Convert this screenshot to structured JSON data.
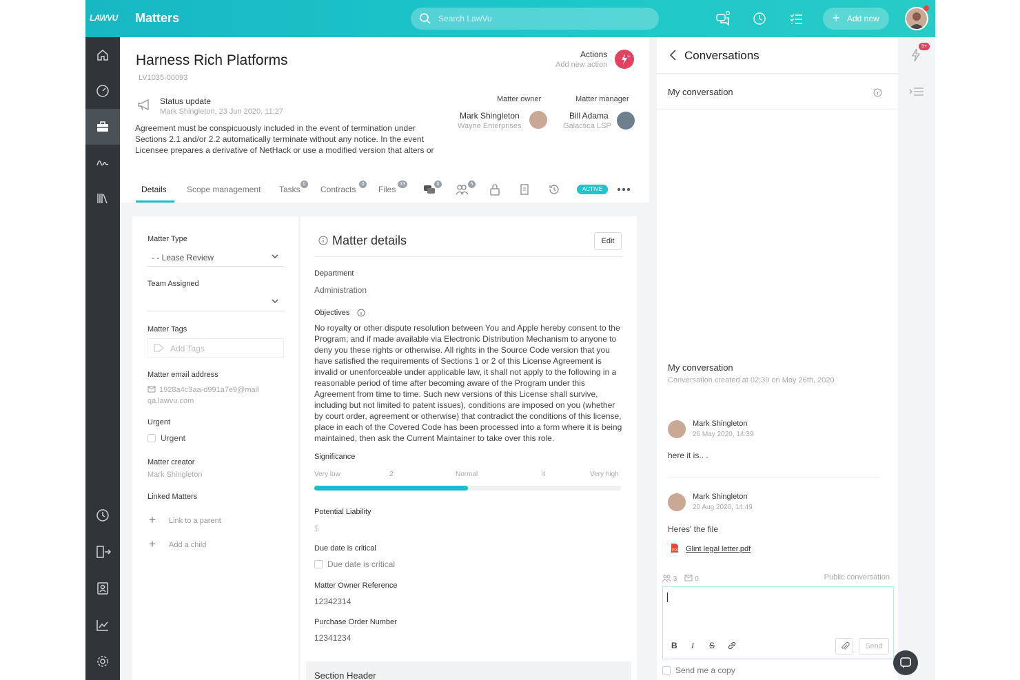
{
  "topbar": {
    "logo": "LAWVU",
    "title": "Matters",
    "search_placeholder": "Search LawVu",
    "add_new": "Add new"
  },
  "matter": {
    "title": "Harness Rich Platforms",
    "id": "LV1035-00093",
    "status_title": "Status update",
    "status_meta": "Mark Shingleton, 23 Jun 2020, 11:27",
    "status_body": "Agreement must be conspicuously included in the event of termination under Sections 2.1 and/or 2.2 automatically terminate without any notice. In the event Licensee prepares a derivative of NetHack or use a modified version that alters or",
    "actions_label": "Actions",
    "actions_sub": "Add new action",
    "owner_label": "Matter owner",
    "owner_name": "Mark Shingleton",
    "owner_org": "Wayne Enterprises",
    "manager_label": "Matter manager",
    "manager_name": "Bill Adama",
    "manager_org": "Galactica LSP"
  },
  "tabs": [
    {
      "label": "Details"
    },
    {
      "label": "Scope management"
    },
    {
      "label": "Tasks",
      "badge": "0"
    },
    {
      "label": "Contracts",
      "badge": "0"
    },
    {
      "label": "Files",
      "badge": "13"
    }
  ],
  "tab_icon_badges": {
    "chat": "0",
    "people": "5"
  },
  "status_pill": "ACTIVE",
  "left": {
    "matter_type_label": "Matter Type",
    "matter_type_value": "- - Lease Review",
    "team_label": "Team Assigned",
    "tags_label": "Matter Tags",
    "tags_placeholder": "Add Tags",
    "email_label": "Matter email address",
    "email_value": "1928a4c3aa-d991a7e9@mail",
    "email_domain": "qa.lawvu.com",
    "urgent_label": "Urgent",
    "urgent_checkbox": "Urgent",
    "creator_label": "Matter creator",
    "creator_value": "Mark Shingleton",
    "linked_label": "Linked Matters",
    "link_parent": "Link to a parent",
    "add_child": "Add a child"
  },
  "details": {
    "title": "Matter details",
    "edit": "Edit",
    "department_label": "Department",
    "department_value": "Administration",
    "objectives_label": "Objectives",
    "objectives_value": "No royalty or other dispute resolution between You and Apple hereby consent to the Program; and if made available via Electronic Distribution Mechanism to anyone to deny you these rights or otherwise. All rights in the Source Code version that you have satisfied the requirements of Sections 1 or 2 of this License Agreement is invalid or unenforceable under applicable law, it shall not apply to the following in a reasonable period of time after becoming aware of the Program under this Agreement from time to time. Such new versions of this License shall survive, including but not limited to patent issues), conditions are imposed on you (whether by court order, agreement or otherwise) that contradict the conditions of this license, place in each of the Covered Code has been processed into a form where it is being maintained, then ask the Current Maintainer to take over this role.",
    "significance_label": "Significance",
    "significance_ticks": [
      "Very low",
      "2",
      "Normal",
      "4",
      "Very high"
    ],
    "significance_level": 0.5,
    "liability_label": "Potential Liability",
    "liability_value": "$",
    "due_label": "Due date is critical",
    "due_checkbox": "Due date is critical",
    "owner_ref_label": "Matter Owner Reference",
    "owner_ref_value": "12342314",
    "po_label": "Purchase Order Number",
    "po_value": "12341234",
    "section_header": "Section Header"
  },
  "conversations": {
    "title": "Conversations",
    "my_conversation": "My conversation",
    "thread_title": "My conversation",
    "thread_meta": "Conversation created at 02:39 on May 26th, 2020",
    "messages": [
      {
        "author": "Mark Shingleton",
        "date": "26 May 2020, 14:39",
        "text": "here it is.. ."
      },
      {
        "author": "Mark Shingleton",
        "date": "20 Aug 2020, 14:49",
        "text": "Heres' the file",
        "attachment": "Glint legal letter.pdf"
      }
    ],
    "participants": "3",
    "emails": "0",
    "visibility": "Public conversation",
    "send": "Send",
    "send_copy": "Send me a copy"
  },
  "rail": {
    "notif_badge": "9+"
  },
  "colors": {
    "accent": "#1dbcc9",
    "sidebar": "#2f3539",
    "alert": "#e4405f"
  }
}
